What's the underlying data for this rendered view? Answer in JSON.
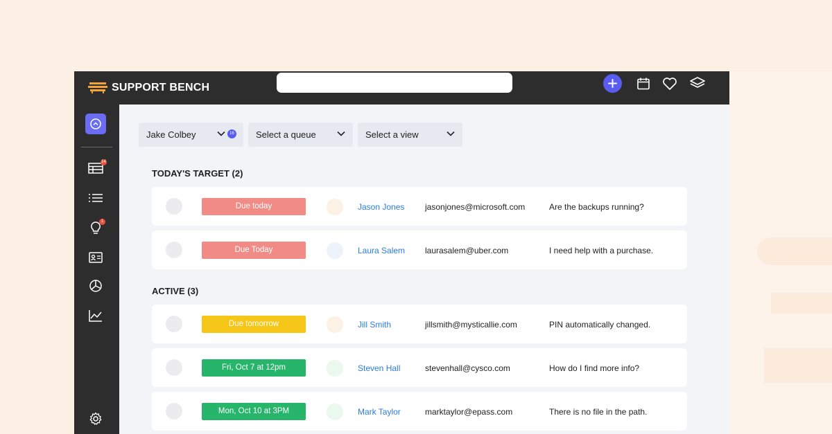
{
  "app": {
    "brand": "SUPPORT BENCH"
  },
  "colors": {
    "accent": "#5a5cf0",
    "due_today": "#f08b86",
    "due_tomorrow": "#f5c518",
    "scheduled": "#27b56b",
    "link": "#2a7de1"
  },
  "topbar": {
    "search": {
      "value": "",
      "placeholder": ""
    },
    "icons": [
      "plus-icon",
      "calendar-icon",
      "heart-icon",
      "layers-icon"
    ]
  },
  "sidebar": {
    "items": [
      {
        "icon": "dashboard-icon",
        "active": true
      },
      {
        "icon": "table-icon",
        "badge": "14"
      },
      {
        "icon": "list-icon"
      },
      {
        "icon": "lightbulb-icon",
        "badge": "1"
      },
      {
        "icon": "contact-card-icon"
      },
      {
        "icon": "pie-chart-icon"
      },
      {
        "icon": "line-chart-icon"
      },
      {
        "icon": "gear-icon"
      }
    ]
  },
  "filters": {
    "agent": {
      "label": "Jake Colbey",
      "count": "16"
    },
    "queue": {
      "label": "Select a queue"
    },
    "view": {
      "label": "Select a view"
    }
  },
  "sections": [
    {
      "title": "TODAY'S TARGET (2)",
      "rows": [
        {
          "due": "Due today",
          "status": "due_today",
          "avatar_color": "#fdf1e6",
          "name": "Jason Jones",
          "email": "jasonjones@microsoft.com",
          "subject": "Are the backups running?"
        },
        {
          "due": "Due Today",
          "status": "due_today",
          "avatar_color": "#eef3fb",
          "name": "Laura Salem",
          "email": "laurasalem@uber.com",
          "subject": "I need help with a purchase."
        }
      ]
    },
    {
      "title": "ACTIVE (3)",
      "rows": [
        {
          "due": "Due tomorrow",
          "status": "due_tomorrow",
          "avatar_color": "#fdf1e6",
          "name": "Jill Smith",
          "email": "jillsmith@mysticallie.com",
          "subject": "PIN automatically changed."
        },
        {
          "due": "Fri, Oct 7 at 12pm",
          "status": "scheduled",
          "avatar_color": "#ebf8ee",
          "name": "Steven Hall",
          "email": "stevenhall@cysco.com",
          "subject": "How do I find more info?"
        },
        {
          "due": "Mon, Oct 10 at 3PM",
          "status": "scheduled",
          "avatar_color": "#ebf8ee",
          "name": "Mark Taylor",
          "email": "marktaylor@epass.com",
          "subject": "There is no file in the path."
        }
      ]
    }
  ]
}
